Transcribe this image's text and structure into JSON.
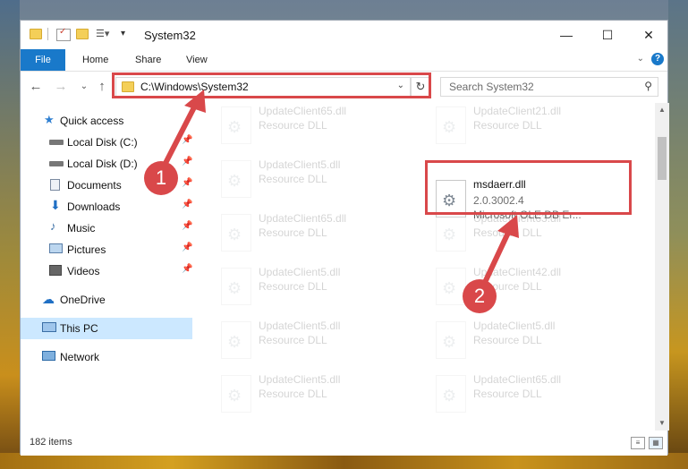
{
  "window": {
    "title": "System32",
    "controls": {
      "minimize": "—",
      "maximize": "☐",
      "close": "✕"
    }
  },
  "ribbon": {
    "tabs": [
      {
        "label": "File"
      },
      {
        "label": "Home"
      },
      {
        "label": "Share"
      },
      {
        "label": "View"
      }
    ],
    "help": "?"
  },
  "navigation": {
    "address_path": "C:\\Windows\\System32",
    "search_placeholder": "Search System32"
  },
  "sidebar": {
    "items": [
      {
        "label": "Quick access",
        "icon": "star-icon"
      },
      {
        "label": "Local Disk (C:)",
        "icon": "drive-icon",
        "pinned": true
      },
      {
        "label": "Local Disk (D:)",
        "icon": "drive-icon",
        "pinned": true
      },
      {
        "label": "Documents",
        "icon": "documents-icon",
        "pinned": true
      },
      {
        "label": "Downloads",
        "icon": "downloads-icon",
        "pinned": true
      },
      {
        "label": "Music",
        "icon": "music-icon",
        "pinned": true
      },
      {
        "label": "Pictures",
        "icon": "pictures-icon",
        "pinned": true
      },
      {
        "label": "Videos",
        "icon": "videos-icon",
        "pinned": true
      },
      {
        "label": "OneDrive",
        "icon": "onedrive-icon"
      },
      {
        "label": "This PC",
        "icon": "computer-icon",
        "selected": true
      },
      {
        "label": "Network",
        "icon": "network-icon"
      }
    ]
  },
  "files": [
    {
      "name": "UpdateClient65.dll",
      "type": "Resource DLL"
    },
    {
      "name": "UpdateClient21.dll",
      "type": "Resource DLL"
    },
    {
      "name": "UpdateClient5.dll",
      "type": "Resource DLL"
    },
    {
      "name": "msdaerr.dll",
      "version": "2.0.3002.4",
      "description": "Microsoft OLE DB Er...",
      "highlighted": true
    },
    {
      "name": "UpdateClient65.dll",
      "type": "Resource DLL"
    },
    {
      "name": "UpdateClient63.dll",
      "type": "Resource DLL"
    },
    {
      "name": "UpdateClient5.dll",
      "type": "Resource DLL"
    },
    {
      "name": "UpdateClient42.dll",
      "type": "Resource DLL"
    },
    {
      "name": "UpdateClient5.dll",
      "type": "Resource DLL"
    },
    {
      "name": "UpdateClient5.dll",
      "type": "Resource DLL"
    },
    {
      "name": "UpdateClient5.dll",
      "type": "Resource DLL"
    },
    {
      "name": "UpdateClient65.dll",
      "type": "Resource DLL"
    }
  ],
  "status": {
    "item_count": "182 items"
  },
  "annotations": [
    {
      "number": "1"
    },
    {
      "number": "2"
    }
  ],
  "colors": {
    "accent": "#1979ca",
    "highlight": "#d9484a",
    "selected": "#cce8ff"
  }
}
